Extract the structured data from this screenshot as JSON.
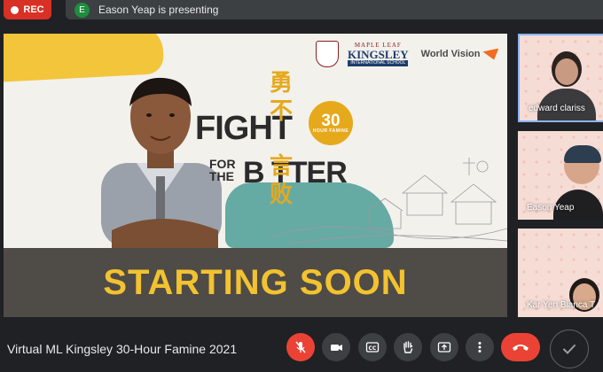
{
  "recording": {
    "label": "REC"
  },
  "presenter": {
    "initial": "E",
    "text": "Eason Yeap is presenting"
  },
  "slide": {
    "school_line1": "MAPLE LEAF",
    "school_line2": "KINGSLEY",
    "school_line3": "INTERNATIONAL SCHOOL",
    "partner": "World Vision",
    "headline_fight": "FIGHT",
    "headline_forthe": "FOR THE",
    "headline_better": "B  TTER",
    "chinese": [
      "勇",
      "不",
      "言",
      "败"
    ],
    "badge_number": "30",
    "badge_sub": "HOUR FAMINE",
    "banner_text": "STARTING SOON"
  },
  "participants": [
    {
      "name": "edward clariss",
      "active": true
    },
    {
      "name": "Eason Yeap",
      "active": false
    },
    {
      "name": "Kar Yen Bianca T",
      "active": false
    }
  ],
  "meeting": {
    "title": "Virtual ML Kingsley 30-Hour Famine 2021"
  },
  "controls": [
    {
      "id": "mic",
      "icon": "mic-off-icon",
      "state": "muted",
      "color": "#ea4335"
    },
    {
      "id": "camera",
      "icon": "camera-icon"
    },
    {
      "id": "captions",
      "icon": "captions-icon"
    },
    {
      "id": "raise-hand",
      "icon": "hand-icon"
    },
    {
      "id": "present",
      "icon": "present-screen-icon"
    },
    {
      "id": "more",
      "icon": "more-vert-icon"
    },
    {
      "id": "end-call",
      "icon": "end-call-icon",
      "color": "#ea4335"
    },
    {
      "id": "check",
      "icon": "check-icon"
    }
  ],
  "colors": {
    "accent": "#8ab4f8",
    "rec": "#d93025",
    "gold": "#f2c230",
    "background": "#202124"
  }
}
